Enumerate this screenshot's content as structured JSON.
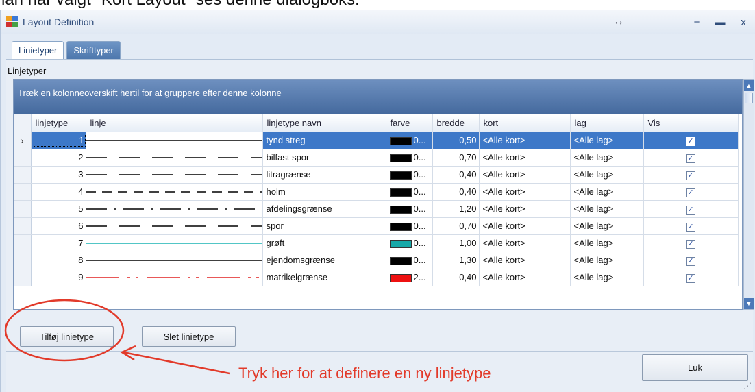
{
  "top_caption": "lan når valgt \"Kort Layout\" ses denne dialogboks.",
  "window": {
    "title": "Layout Definition",
    "resize_glyph": "↔",
    "minimize_glyph": "−",
    "maximize_glyph": "▬",
    "close_glyph": "x"
  },
  "tabs": [
    {
      "label": "Linietyper",
      "active": true
    },
    {
      "label": "Skrifttyper",
      "active": false
    }
  ],
  "group_label": "Linjetyper",
  "grid": {
    "group_hint": "Træk en kolonneoverskift hertil for at gruppere efter denne kolonne",
    "columns": [
      "linjetype",
      "linje",
      "linjetype navn",
      "farve",
      "bredde",
      "kort",
      "lag",
      "Vis"
    ],
    "rows": [
      {
        "linjetype": "1",
        "pattern": "solid",
        "line_color": "#000000",
        "navn": "tynd streg",
        "farve_color": "#000000",
        "farve": "0...",
        "bredde": "0,50",
        "kort": "<Alle kort>",
        "lag": "<Alle lag>",
        "vis": true,
        "selected": true
      },
      {
        "linjetype": "2",
        "pattern": "longdash",
        "line_color": "#000000",
        "navn": "bilfast spor",
        "farve_color": "#000000",
        "farve": "0...",
        "bredde": "0,70",
        "kort": "<Alle kort>",
        "lag": "<Alle lag>",
        "vis": true,
        "selected": false
      },
      {
        "linjetype": "3",
        "pattern": "longdash",
        "line_color": "#000000",
        "navn": "litragrænse",
        "farve_color": "#000000",
        "farve": "0...",
        "bredde": "0,40",
        "kort": "<Alle kort>",
        "lag": "<Alle lag>",
        "vis": true,
        "selected": false
      },
      {
        "linjetype": "4",
        "pattern": "dash",
        "line_color": "#000000",
        "navn": "holm",
        "farve_color": "#000000",
        "farve": "0...",
        "bredde": "0,40",
        "kort": "<Alle kort>",
        "lag": "<Alle lag>",
        "vis": true,
        "selected": false
      },
      {
        "linjetype": "5",
        "pattern": "dashdot",
        "line_color": "#000000",
        "navn": "afdelingsgrænse",
        "farve_color": "#000000",
        "farve": "0...",
        "bredde": "1,20",
        "kort": "<Alle kort>",
        "lag": "<Alle lag>",
        "vis": true,
        "selected": false
      },
      {
        "linjetype": "6",
        "pattern": "longdash",
        "line_color": "#000000",
        "navn": "spor",
        "farve_color": "#000000",
        "farve": "0...",
        "bredde": "0,70",
        "kort": "<Alle kort>",
        "lag": "<Alle lag>",
        "vis": true,
        "selected": false
      },
      {
        "linjetype": "7",
        "pattern": "solid",
        "line_color": "#18b4b4",
        "navn": "grøft",
        "farve_color": "#16a8a8",
        "farve": "0...",
        "bredde": "1,00",
        "kort": "<Alle kort>",
        "lag": "<Alle lag>",
        "vis": true,
        "selected": false
      },
      {
        "linjetype": "8",
        "pattern": "solid",
        "line_color": "#000000",
        "navn": "ejendomsgrænse",
        "farve_color": "#000000",
        "farve": "0...",
        "bredde": "1,30",
        "kort": "<Alle kort>",
        "lag": "<Alle lag>",
        "vis": true,
        "selected": false
      },
      {
        "linjetype": "9",
        "pattern": "dashdotdot",
        "line_color": "#e02020",
        "navn": "matrikelgrænse",
        "farve_color": "#ee1111",
        "farve": "2...",
        "bredde": "0,40",
        "kort": "<Alle kort>",
        "lag": "<Alle lag>",
        "vis": true,
        "selected": false
      }
    ]
  },
  "buttons": {
    "add": "Tilføj linietype",
    "delete": "Slet linietype",
    "close": "Luk"
  },
  "annotation": {
    "text": "Tryk her for at definere en ny linjetype",
    "color": "#e23a2a"
  },
  "colors": {
    "selection": "#3d78c8",
    "group_bar": "#44699d",
    "window_bg": "#e3ebf5"
  }
}
